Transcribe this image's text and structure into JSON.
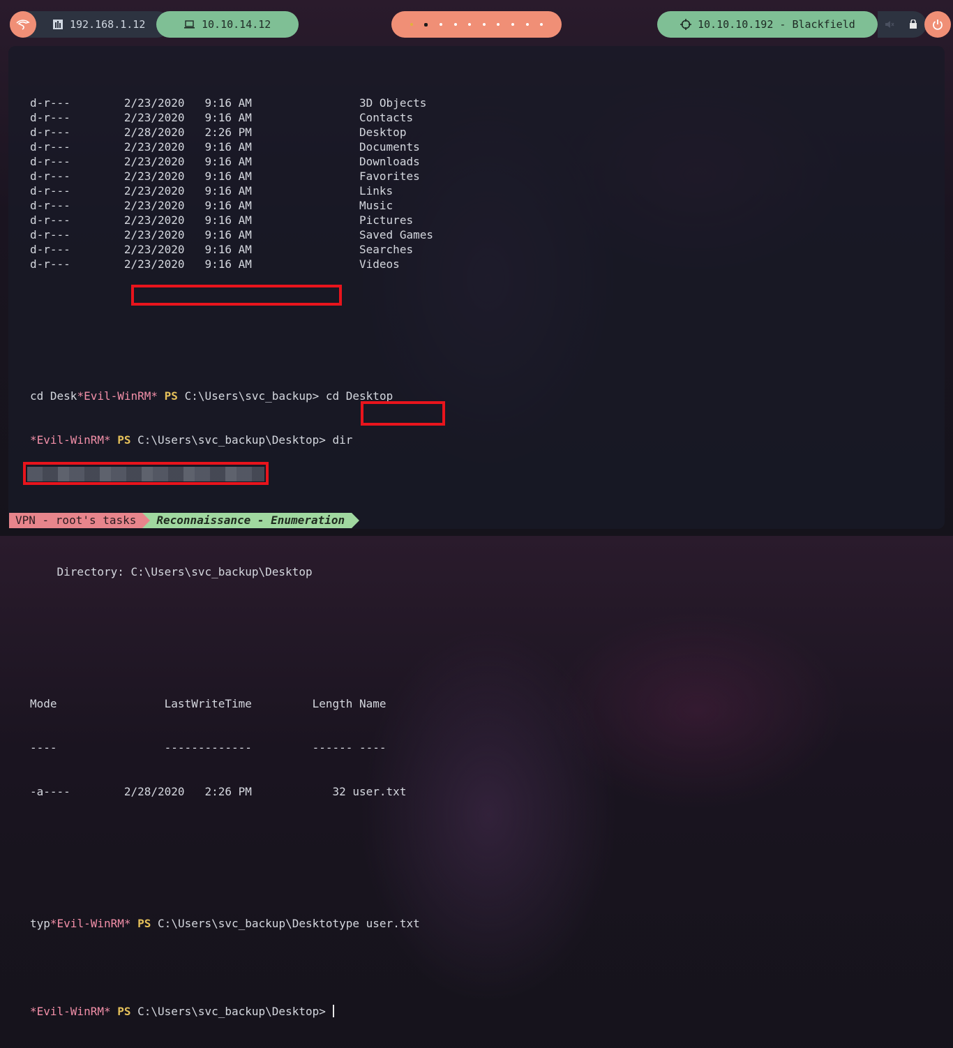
{
  "topbar": {
    "ip_local": "192.168.1.12",
    "ip_vpn": "10.10.14.12",
    "workspaces": [
      "ws1",
      "ws2",
      "ws3",
      "ws4",
      "ws5",
      "ws6",
      "ws7",
      "ws8",
      "ws9",
      "ws10"
    ],
    "active_workspace": 2,
    "target": "10.10.10.192 - Blackfield",
    "icons": [
      "kali-dragon-icon",
      "network-icon",
      "monitor-icon",
      "crosshair-icon",
      "volume-mute-icon",
      "lock-icon",
      "power-icon"
    ],
    "colors": {
      "accent": "#f08f76",
      "green": "#7fbf95",
      "dark": "#2d3340"
    }
  },
  "terminal": {
    "dir_listing": [
      {
        "mode": "d-r---",
        "date": "2/23/2020",
        "time": "9:16 AM",
        "name": "3D Objects"
      },
      {
        "mode": "d-r---",
        "date": "2/23/2020",
        "time": "9:16 AM",
        "name": "Contacts"
      },
      {
        "mode": "d-r---",
        "date": "2/28/2020",
        "time": "2:26 PM",
        "name": "Desktop"
      },
      {
        "mode": "d-r---",
        "date": "2/23/2020",
        "time": "9:16 AM",
        "name": "Documents"
      },
      {
        "mode": "d-r---",
        "date": "2/23/2020",
        "time": "9:16 AM",
        "name": "Downloads"
      },
      {
        "mode": "d-r---",
        "date": "2/23/2020",
        "time": "9:16 AM",
        "name": "Favorites"
      },
      {
        "mode": "d-r---",
        "date": "2/23/2020",
        "time": "9:16 AM",
        "name": "Links"
      },
      {
        "mode": "d-r---",
        "date": "2/23/2020",
        "time": "9:16 AM",
        "name": "Music"
      },
      {
        "mode": "d-r---",
        "date": "2/23/2020",
        "time": "9:16 AM",
        "name": "Pictures"
      },
      {
        "mode": "d-r---",
        "date": "2/23/2020",
        "time": "9:16 AM",
        "name": "Saved Games"
      },
      {
        "mode": "d-r---",
        "date": "2/23/2020",
        "time": "9:16 AM",
        "name": "Searches"
      },
      {
        "mode": "d-r---",
        "date": "2/23/2020",
        "time": "9:16 AM",
        "name": "Videos"
      }
    ],
    "prompt_name": "*Evil-WinRM*",
    "prompt_ps": "PS",
    "cmd1_prefix": "cd Desk",
    "cmd1_path": "C:\\Users\\svc_backup>",
    "cmd1_cmd": "cd Desktop",
    "cmd2_path": "C:\\Users\\svc_backup\\Desktop>",
    "cmd2_cmd": "dir",
    "directory_header": "    Directory: C:\\Users\\svc_backup\\Desktop",
    "table_header": "Mode                LastWriteTime         Length Name",
    "table_rule": "----                -------------         ------ ----",
    "file_row": {
      "mode": "-a----",
      "date": "2/28/2020",
      "time": "2:26 PM",
      "length": "32",
      "name": "user.txt"
    },
    "cmd3_prefix": "typ",
    "cmd3_path": "C:\\Users\\svc_backup\\Deskto",
    "cmd3_cmd": "type user.txt",
    "final_path": "C:\\Users\\svc_backup\\Desktop>"
  },
  "statusbar": {
    "session": "VPN - root's tasks",
    "window": "Reconnaissance - Enumeration"
  }
}
